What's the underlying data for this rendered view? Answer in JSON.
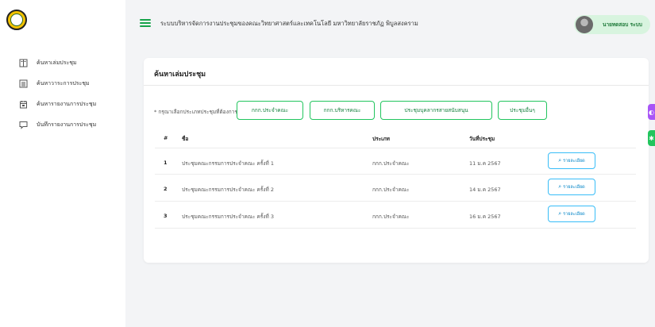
{
  "header": {
    "system_title": "ระบบบริหารจัดการงานประชุมของคณะวิทยาศาสตร์และเทคโนโลยี มหาวิทยาลัยราชภัฏ พิบูลสงคราม",
    "user_name": "นายทดสอบ ระบบ"
  },
  "sidebar": {
    "items": [
      {
        "label": "ค้นหาเล่มประชุม",
        "icon": "book-icon"
      },
      {
        "label": "ค้นหาวาระการประชุม",
        "icon": "list-icon"
      },
      {
        "label": "ค้นหารายงานการประชุม",
        "icon": "calendar-icon"
      },
      {
        "label": "บันทึกรายงานการประชุม",
        "icon": "comment-icon"
      }
    ]
  },
  "card": {
    "title": "ค้นหาเล่มประชุม",
    "filter_label": "* กรุณาเลือกประเภทประชุมที่ต้องการ",
    "filters": [
      "กกก.ประจำคณะ",
      "กกก.บริหารคณะ",
      "ประชุมบุคลากรสายสนับสนุน",
      "ประชุมอื่นๆ"
    ]
  },
  "table": {
    "headers": {
      "num": "#",
      "name": "ชื่อ",
      "type": "ประเภท",
      "date": "วันที่ประชุม"
    },
    "detail_label": "รายละเอียด",
    "rows": [
      {
        "num": "1",
        "name": "ประชุมคณะกรรมการประจำคณะ ครั้งที่ 1",
        "type": "กกก.ประจำคณะ",
        "date": "11 ม.ค 2567"
      },
      {
        "num": "2",
        "name": "ประชุมคณะกรรมการประจำคณะ ครั้งที่ 2",
        "type": "กกก.ประจำคณะ",
        "date": "14 ม.ค 2567"
      },
      {
        "num": "3",
        "name": "ประชุมคณะกรรมการประจำคณะ ครั้งที่ 3",
        "type": "กกก.ประจำคณะ",
        "date": "16 ม.ค 2567"
      }
    ]
  },
  "colors": {
    "accent": "#22c55e",
    "side_tab_top": "#a855f7",
    "side_tab_bottom": "#22c55e"
  }
}
